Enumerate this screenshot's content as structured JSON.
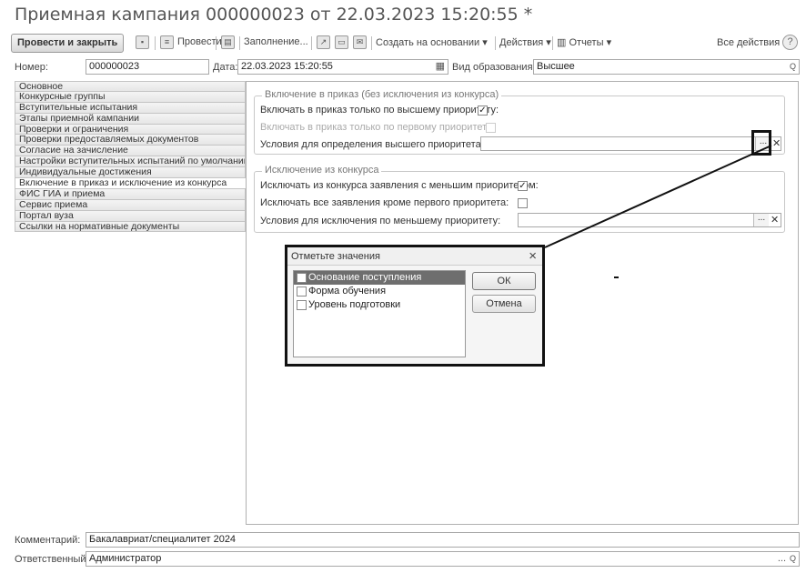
{
  "window": {
    "title": "Приемная кампания 000000023 от 22.03.2023 15:20:55 *"
  },
  "toolbar": {
    "post_and_close": "Провести и закрыть",
    "post": "Провести",
    "fill": "Заполнение...",
    "create_based_on": "Создать на основании",
    "actions": "Действия",
    "reports": "Отчеты",
    "all_actions": "Все действия",
    "help": "?"
  },
  "header": {
    "number_label": "Номер:",
    "number_value": "000000023",
    "date_label": "Дата:",
    "date_value": "22.03.2023 15:20:55",
    "edu_type_label": "Вид образования:",
    "edu_type_value": "Высшее"
  },
  "nav": {
    "items": [
      {
        "label": "Основное",
        "active": false
      },
      {
        "label": "Конкурсные группы",
        "active": false
      },
      {
        "label": "Вступительные испытания",
        "active": false
      },
      {
        "label": "Этапы приемной кампании",
        "active": false
      },
      {
        "label": "Проверки и ограничения",
        "active": false
      },
      {
        "label": "Проверки предоставляемых документов",
        "active": false
      },
      {
        "label": "Согласие на зачисление",
        "active": false
      },
      {
        "label": "Настройки вступительных испытаний по умолчанию",
        "active": false
      },
      {
        "label": "Индивидуальные достижения",
        "active": false
      },
      {
        "label": "Включение в приказ и исключение из конкурса",
        "active": true
      },
      {
        "label": "ФИС ГИА и приема",
        "active": false
      },
      {
        "label": "Сервис приема",
        "active": false
      },
      {
        "label": "Портал вуза",
        "active": false
      },
      {
        "label": "Ссылки на нормативные документы",
        "active": false
      }
    ]
  },
  "inclusion_group": {
    "title": "Включение в приказ (без исключения из конкурса)",
    "highest_priority_label": "Включать в приказ только по высшему приоритету:",
    "highest_priority_checked": true,
    "first_priority_label": "Включать в приказ только по первому приоритету:",
    "first_priority_checked": false,
    "conditions_label": "Условия для определения высшего приоритета:",
    "conditions_value": ""
  },
  "exclusion_group": {
    "title": "Исключение из конкурса",
    "lower_priority_label": "Исключать из конкурса заявления с меньшим приоритетом:",
    "lower_priority_checked": true,
    "except_first_label": "Исключать все заявления кроме первого приоритета:",
    "except_first_checked": false,
    "conditions_label": "Условия для исключения по меньшему приоритету:",
    "conditions_value": ""
  },
  "dialog": {
    "title": "Отметьте значения",
    "close_glyph": "×",
    "items": [
      {
        "label": "Основание поступления",
        "checked": false,
        "selected": true
      },
      {
        "label": "Форма обучения",
        "checked": false,
        "selected": false
      },
      {
        "label": "Уровень подготовки",
        "checked": false,
        "selected": false
      }
    ],
    "ok_label": "ОК",
    "cancel_label": "Отмена"
  },
  "footer": {
    "comment_label": "Комментарий:",
    "comment_value": "Бакалавриат/специалитет 2024",
    "responsible_label": "Ответственный:",
    "responsible_value": "Администратор"
  },
  "glyphs": {
    "check": "✓",
    "dots": "...",
    "clear": "✕",
    "search": "🔍",
    "calendar": "▦",
    "dropdown": "▾"
  }
}
